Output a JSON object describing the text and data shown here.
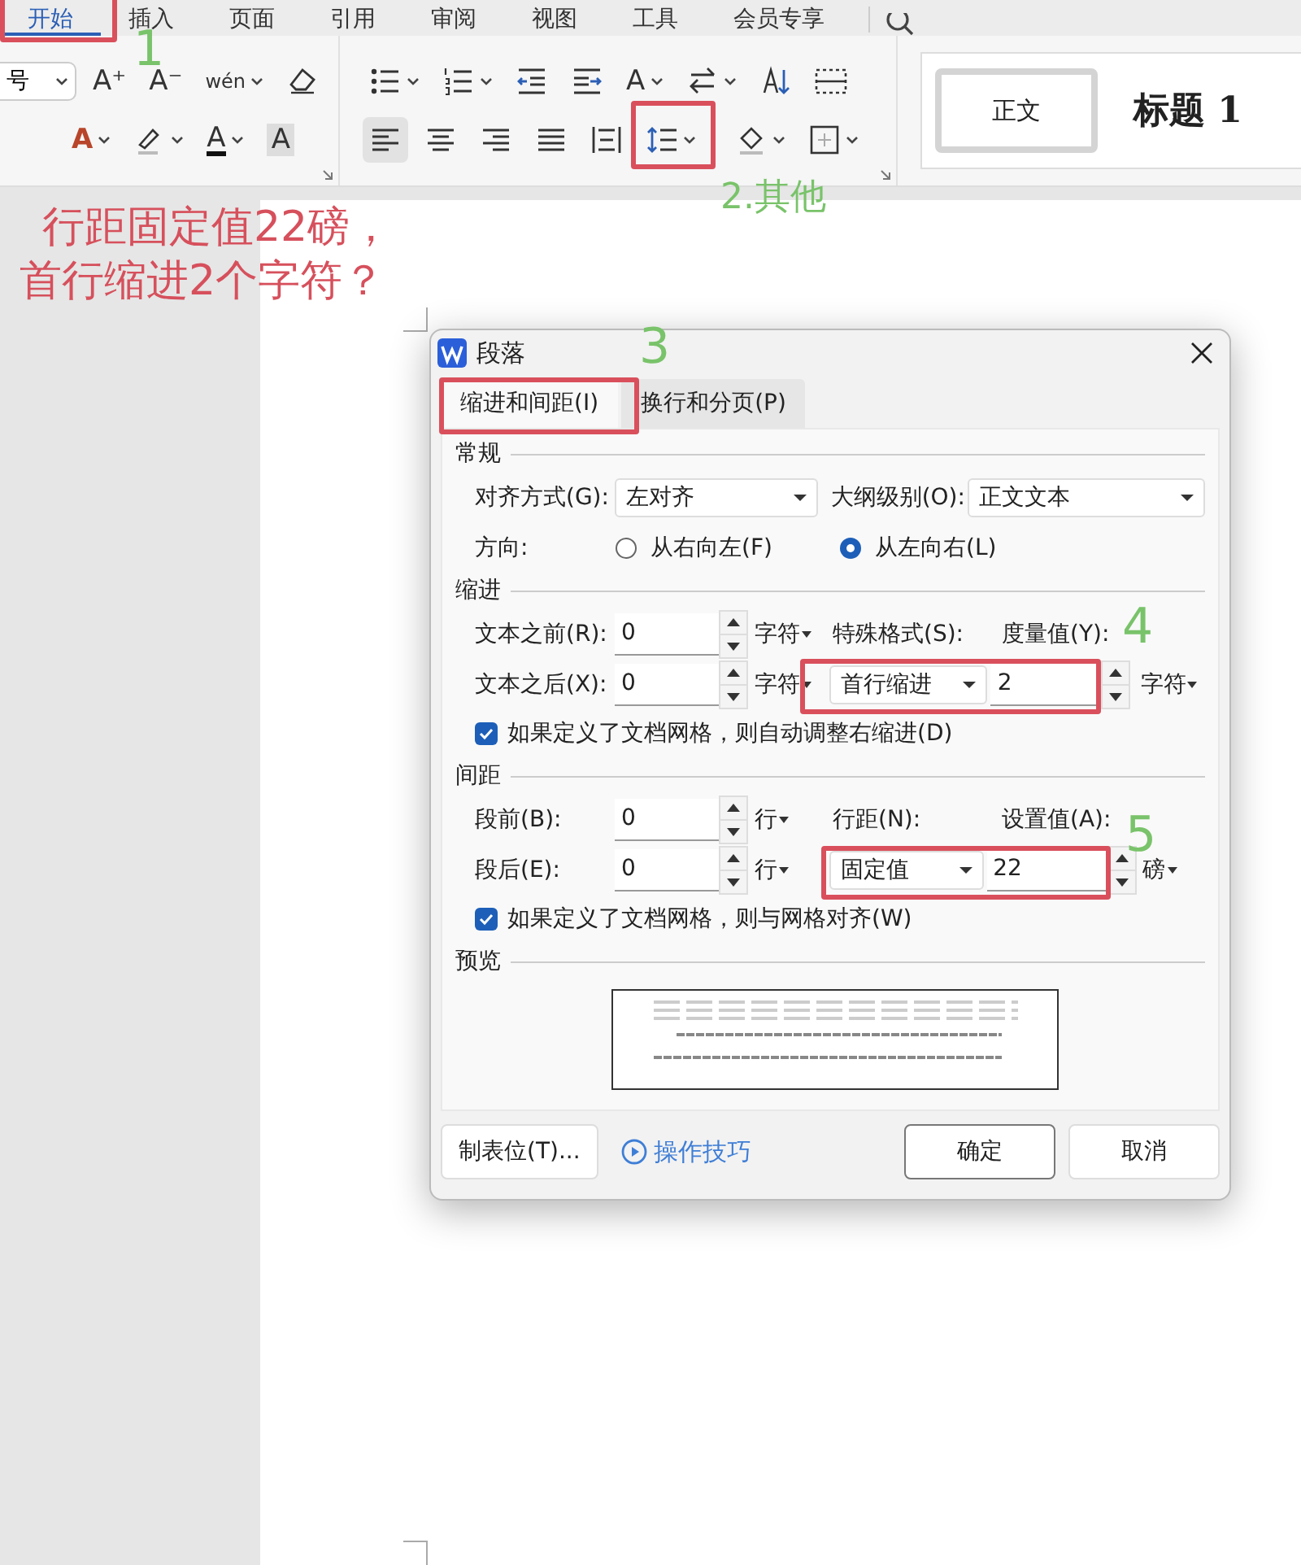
{
  "menu_tabs": [
    {
      "label": "开始",
      "selected": true
    },
    {
      "label": "插入",
      "selected": false
    },
    {
      "label": "页面",
      "selected": false
    },
    {
      "label": "引用",
      "selected": false
    },
    {
      "label": "审阅",
      "selected": false
    },
    {
      "label": "视图",
      "selected": false
    },
    {
      "label": "工具",
      "selected": false
    },
    {
      "label": "会员专享",
      "selected": false
    }
  ],
  "ribbon": {
    "font_size": "号",
    "font_rows": [
      [
        {
          "kind": "grow",
          "glyph": "A⁺",
          "dropdown": false,
          "selected": false
        },
        {
          "kind": "shrink",
          "glyph": "A⁻",
          "dropdown": false,
          "selected": false
        },
        {
          "kind": "pinyin",
          "glyph": "wén",
          "dropdown": true,
          "selected": false
        },
        {
          "kind": "eraser",
          "dropdown": false,
          "selected": false
        }
      ],
      [
        {
          "kind": "outline",
          "glyph": "A",
          "dropdown": true,
          "selected": false
        },
        {
          "kind": "highlight",
          "dropdown": true,
          "selected": false
        },
        {
          "kind": "fontcolor",
          "glyph": "A",
          "dropdown": true,
          "selected": false
        },
        {
          "kind": "shaded",
          "glyph": "A",
          "dropdown": false,
          "selected": false
        }
      ]
    ],
    "para_rows": [
      [
        {
          "kind": "bullets",
          "dropdown": true,
          "selected": false
        },
        {
          "kind": "numbering",
          "dropdown": true,
          "selected": false
        },
        {
          "kind": "outdent",
          "dropdown": false,
          "selected": false
        },
        {
          "kind": "indent",
          "dropdown": false,
          "selected": false
        },
        {
          "kind": "textdir",
          "glyph": "A",
          "dropdown": true,
          "selected": false
        },
        {
          "kind": "swap",
          "dropdown": true,
          "selected": false
        },
        {
          "kind": "sort",
          "dropdown": false,
          "selected": false
        },
        {
          "kind": "spacing",
          "dropdown": false,
          "selected": false
        }
      ],
      [
        {
          "kind": "left",
          "dropdown": false,
          "selected": true
        },
        {
          "kind": "center",
          "dropdown": false,
          "selected": false
        },
        {
          "kind": "right",
          "dropdown": false,
          "selected": false
        },
        {
          "kind": "justify",
          "dropdown": false,
          "selected": false
        },
        {
          "kind": "distribute",
          "dropdown": false,
          "selected": false
        },
        {
          "kind": "linespacing",
          "dropdown": true,
          "selected": false
        },
        {
          "kind": "shading",
          "dropdown": true,
          "selected": false
        },
        {
          "kind": "borders",
          "dropdown": true,
          "selected": false
        }
      ]
    ],
    "styles": [
      {
        "label": "正文",
        "selected": true
      },
      {
        "label": "标题 1",
        "selected": false
      }
    ]
  },
  "annotations": {
    "question": [
      "行距固定值22磅，",
      "首行缩进2个字符？"
    ],
    "steps": [
      "1",
      "2.其他",
      "3",
      "4",
      "5"
    ]
  },
  "dialog": {
    "title": "段落",
    "tabs": [
      {
        "label": "缩进和间距(I)",
        "selected": true
      },
      {
        "label": "换行和分页(P)",
        "selected": false
      }
    ],
    "general": {
      "title": "常规",
      "alignment_label": "对齐方式(G):",
      "alignment": "左对齐",
      "outline_label": "大纲级别(O):",
      "outline": "正文文本",
      "direction_label": "方向:",
      "directions": [
        {
          "label": "从右向左(F)",
          "selected": false
        },
        {
          "label": "从左向右(L)",
          "selected": true
        }
      ]
    },
    "indent": {
      "title": "缩进",
      "before_label": "文本之前(R):",
      "before": "0",
      "before_unit": "字符",
      "after_label": "文本之后(X):",
      "after": "0",
      "after_unit": "字符",
      "special_label": "特殊格式(S):",
      "special": "首行缩进",
      "measure_label": "度量值(Y):",
      "measure": "2",
      "measure_unit": "字符",
      "checkbox": {
        "label": "如果定义了文档网格，则自动调整右缩进(D)",
        "checked": true
      }
    },
    "spacing": {
      "title": "间距",
      "before_label": "段前(B):",
      "before": "0",
      "before_unit": "行",
      "after_label": "段后(E):",
      "after": "0",
      "after_unit": "行",
      "line_label": "行距(N):",
      "line": "固定值",
      "value_label": "设置值(A):",
      "value": "22",
      "value_unit": "磅",
      "checkbox": {
        "label": "如果定义了文档网格，则与网格对齐(W)",
        "checked": true
      }
    },
    "preview_title": "预览",
    "tabs_button": "制表位(T)...",
    "tips_link": "操作技巧",
    "ok": "确定",
    "cancel": "取消"
  }
}
